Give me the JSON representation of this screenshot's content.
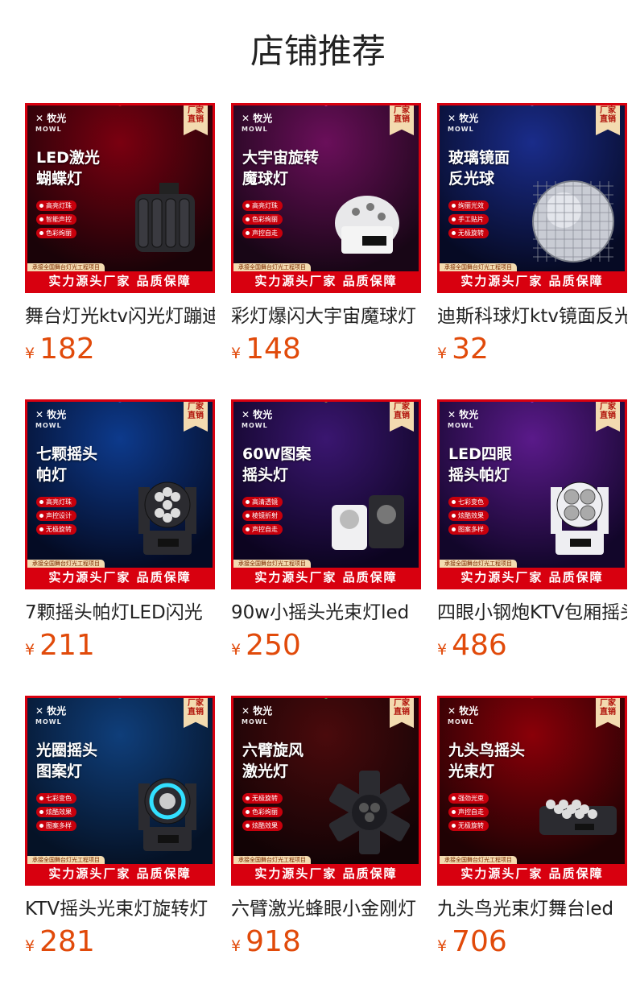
{
  "page": {
    "title": "店铺推荐"
  },
  "products": [
    {
      "title": "舞台灯光ktv闪光灯蹦迪灯",
      "currency": "¥",
      "price": "182",
      "brand": "牧光",
      "brand_sub": "MOWL",
      "badge": "厂家\n直销",
      "headline": "LED激光\n蝴蝶灯",
      "features": [
        "高亮灯珠",
        "智能声控",
        "色彩绚丽"
      ],
      "project_text": "承接全国舞台灯光工程项目",
      "banner": "实力源头厂家 品质保障",
      "bg_colors": [
        "#7a0010",
        "#1a0308"
      ],
      "fixture": "butterfly-light",
      "accent": "#ff2a2a"
    },
    {
      "title": "彩灯爆闪大宇宙魔球灯",
      "currency": "¥",
      "price": "148",
      "brand": "牧光",
      "brand_sub": "MOWL",
      "badge": "厂家\n直销",
      "headline": "大宇宙旋转\n魔球灯",
      "features": [
        "高亮灯珠",
        "色彩绚丽",
        "声控自走"
      ],
      "project_text": "承接全国舞台灯光工程项目",
      "banner": "实力源头厂家 品质保障",
      "bg_colors": [
        "#6a0f5a",
        "#180616"
      ],
      "fixture": "magic-ball",
      "accent": "#ff4fd8"
    },
    {
      "title": "迪斯科球灯ktv镜面反光球",
      "currency": "¥",
      "price": "32",
      "brand": "牧光",
      "brand_sub": "MOWL",
      "badge": "厂家\n直销",
      "headline": "玻璃镜面\n反光球",
      "features": [
        "绚丽光效",
        "手工贴片",
        "无极旋转"
      ],
      "project_text": "承接全国舞台灯光工程项目",
      "banner": "实力源头厂家 品质保障",
      "bg_colors": [
        "#1a2c8a",
        "#060a24"
      ],
      "fixture": "mirror-ball",
      "accent": "#6aa0ff"
    },
    {
      "title": "7颗摇头帕灯LED闪光",
      "currency": "¥",
      "price": "211",
      "brand": "牧光",
      "brand_sub": "MOWL",
      "badge": "厂家\n直销",
      "headline": "七颗摇头\n帕灯",
      "features": [
        "高亮灯珠",
        "声控设计",
        "无极旋转"
      ],
      "project_text": "承接全国舞台灯光工程项目",
      "banner": "实力源头厂家 品质保障",
      "bg_colors": [
        "#0d3a8c",
        "#040b24"
      ],
      "fixture": "moving-par",
      "accent": "#3a8cff"
    },
    {
      "title": "90w小摇头光束灯led",
      "currency": "¥",
      "price": "250",
      "brand": "牧光",
      "brand_sub": "MOWL",
      "badge": "厂家\n直销",
      "headline": "60W图案\n摇头灯",
      "features": [
        "高清透镜",
        "棱镜折射",
        "声控自走"
      ],
      "project_text": "承接全国舞台灯光工程项目",
      "banner": "实力源头厂家 品质保障",
      "bg_colors": [
        "#3a1670",
        "#0c0420"
      ],
      "fixture": "pattern-heads",
      "accent": "#ffd23a"
    },
    {
      "title": "四眼小钢炮KTV包厢摇头",
      "currency": "¥",
      "price": "486",
      "brand": "牧光",
      "brand_sub": "MOWL",
      "badge": "厂家\n直销",
      "headline": "LED四眼\n摇头帕灯",
      "features": [
        "七彩变色",
        "炫酷效果",
        "图案多样"
      ],
      "project_text": "承接全国舞台灯光工程项目",
      "banner": "实力源头厂家 品质保障",
      "bg_colors": [
        "#5a1a8a",
        "#12062a"
      ],
      "fixture": "four-eye-head",
      "accent": "#c45aff"
    },
    {
      "title": "KTV摇头光束灯旋转灯",
      "currency": "¥",
      "price": "281",
      "brand": "牧光",
      "brand_sub": "MOWL",
      "badge": "厂家\n直销",
      "headline": "光圈摇头\n图案灯",
      "features": [
        "七彩变色",
        "炫酷效果",
        "图案多样"
      ],
      "project_text": "承接全国舞台灯光工程项目",
      "banner": "实力源头厂家 品质保障",
      "bg_colors": [
        "#0f3e7a",
        "#051226"
      ],
      "fixture": "ring-head",
      "accent": "#32e0ff"
    },
    {
      "title": "六臂激光蜂眼小金刚灯",
      "currency": "¥",
      "price": "918",
      "brand": "牧光",
      "brand_sub": "MOWL",
      "badge": "厂家\n直销",
      "headline": "六臂旋风\n激光灯",
      "features": [
        "无极旋转",
        "色彩绚丽",
        "炫酷效果"
      ],
      "project_text": "承接全国舞台灯光工程项目",
      "banner": "实力源头厂家 品质保障",
      "bg_colors": [
        "#4a0a0c",
        "#120305"
      ],
      "fixture": "six-arm",
      "accent": "#2aff6a"
    },
    {
      "title": "九头鸟光束灯舞台led",
      "currency": "¥",
      "price": "706",
      "brand": "牧光",
      "brand_sub": "MOWL",
      "badge": "厂家\n直销",
      "headline": "九头鸟摇头\n光束灯",
      "features": [
        "强劲光束",
        "声控自走",
        "无极旋转"
      ],
      "project_text": "承接全国舞台灯光工程项目",
      "banner": "实力源头厂家 品质保障",
      "bg_colors": [
        "#8a0008",
        "#200204"
      ],
      "fixture": "nine-head",
      "accent": "#ff3030"
    }
  ]
}
